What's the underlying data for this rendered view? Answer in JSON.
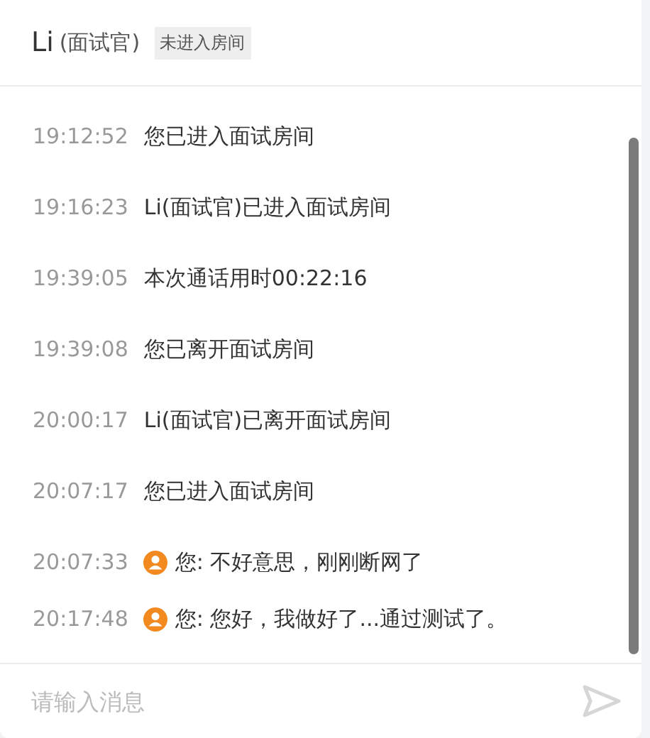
{
  "header": {
    "name": "Li",
    "role": "(面试官)",
    "status": "未进入房间"
  },
  "messages": [
    {
      "kind": "system",
      "time": "19:12:52",
      "text": "您已进入面试房间"
    },
    {
      "kind": "system",
      "time": "19:16:23",
      "text": "Li(面试官)已进入面试房间"
    },
    {
      "kind": "system",
      "time": "19:39:05",
      "text": "本次通话用时00:22:16"
    },
    {
      "kind": "system",
      "time": "19:39:08",
      "text": "您已离开面试房间"
    },
    {
      "kind": "system",
      "time": "20:00:17",
      "text": "Li(面试官)已离开面试房间"
    },
    {
      "kind": "system",
      "time": "20:07:17",
      "text": "您已进入面试房间"
    },
    {
      "kind": "chat",
      "time": "20:07:33",
      "text": "您: 不好意思，刚刚断网了"
    },
    {
      "kind": "chat",
      "time": "20:17:48",
      "text": "您: 您好，我做好了...通过测试了。"
    }
  ],
  "input": {
    "placeholder": "请输入消息"
  }
}
